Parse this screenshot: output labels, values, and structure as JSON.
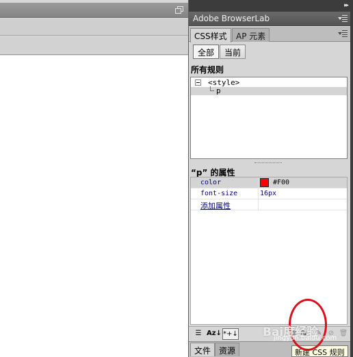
{
  "dock": {
    "browserlab_title": "Adobe BrowserLab"
  },
  "css_panel": {
    "tabs": [
      {
        "label": "CSS样式",
        "active": true
      },
      {
        "label": "AP 元素",
        "active": false
      }
    ],
    "modes": {
      "all": "全部",
      "current": "当前",
      "selected": "all"
    },
    "rules_header": "所有规则",
    "tree": {
      "style_node": "<style>",
      "rule_node": "p"
    },
    "props_header": "“p” 的属性",
    "properties": [
      {
        "name": "color",
        "value": "#F00"
      },
      {
        "name": "font-size",
        "value": "16px"
      }
    ],
    "add_property": "添加属性",
    "toolbar": {
      "alpha_sort": "Az↓",
      "set_props": "*+↓"
    },
    "swatch_color": "#ff0000"
  },
  "bottom_tabs": [
    {
      "label": "文件",
      "active": true
    },
    {
      "label": "资源",
      "active": false
    }
  ],
  "tooltip": "新建 CSS 规则",
  "watermark": {
    "text": "Bai度经验",
    "url": "jingyan.baidu.com"
  }
}
